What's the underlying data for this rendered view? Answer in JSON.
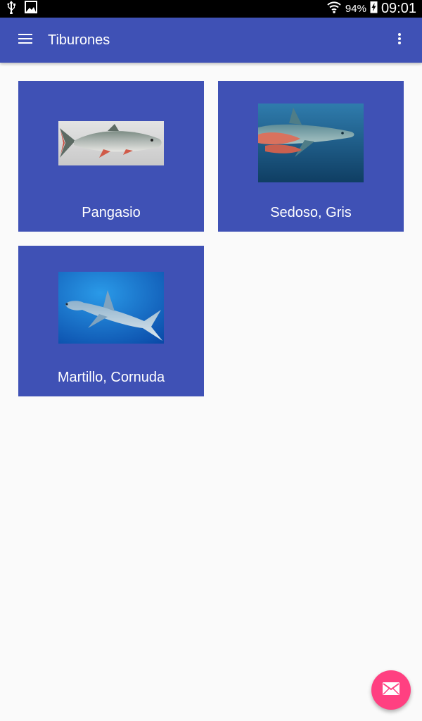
{
  "status_bar": {
    "battery_percent": "94%",
    "time": "09:01",
    "icons": [
      "usb-icon",
      "image-icon",
      "wifi-icon",
      "battery-charging-icon"
    ]
  },
  "app_bar": {
    "title": "Tiburones",
    "icons": [
      "menu-icon",
      "more-vert-icon"
    ]
  },
  "cards": [
    {
      "label": "Pangasio",
      "image": "pangasius-fish-image"
    },
    {
      "label": "Sedoso, Gris",
      "image": "silky-shark-image"
    },
    {
      "label": "Martillo, Cornuda",
      "image": "hammerhead-shark-image"
    }
  ],
  "fab": {
    "icon": "email-icon"
  },
  "colors": {
    "primary": "#3f51b5",
    "accent": "#ff4081",
    "background": "#fafafa",
    "status_bar": "#000000"
  }
}
